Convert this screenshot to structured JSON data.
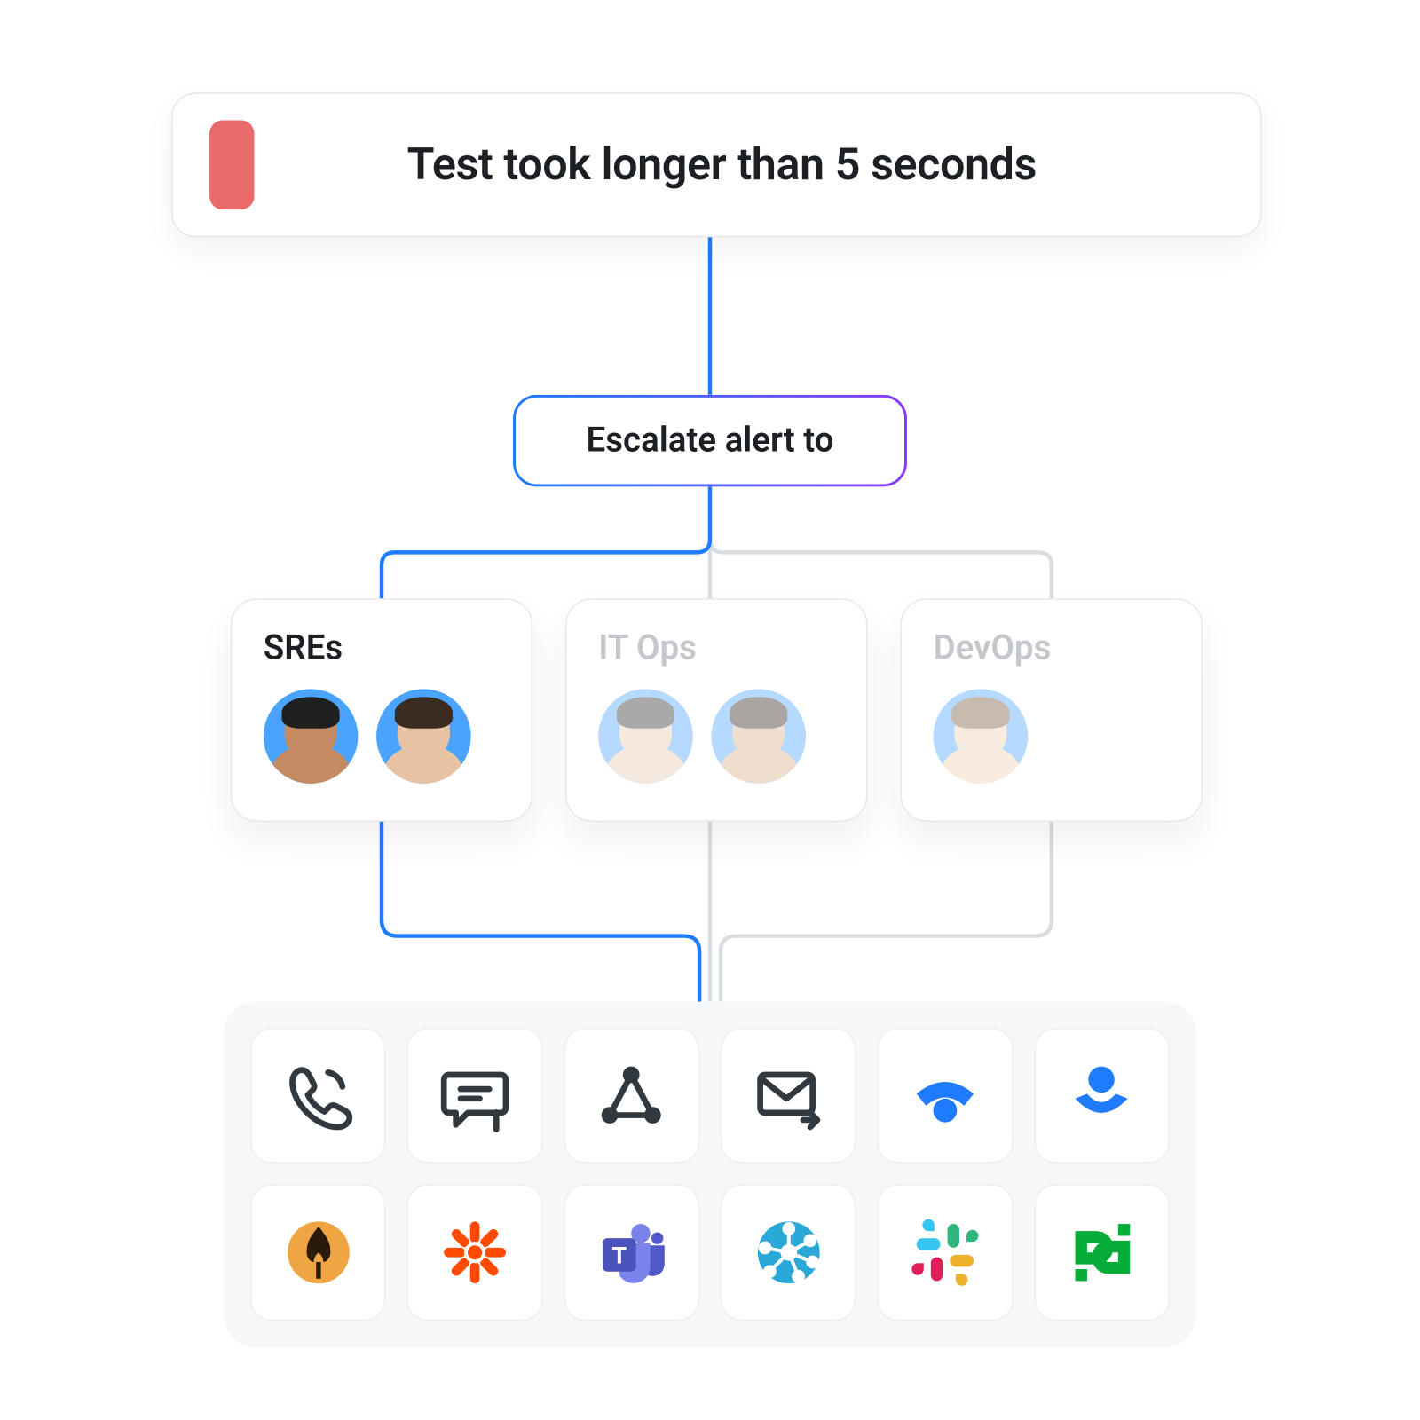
{
  "alert": {
    "text": "Test took longer than 5 seconds",
    "severity_color": "#e86a6a"
  },
  "escalate": {
    "label": "Escalate alert to"
  },
  "teams": [
    {
      "name": "SREs",
      "active": true,
      "members": 2
    },
    {
      "name": "IT Ops",
      "active": false,
      "members": 2
    },
    {
      "name": "DevOps",
      "active": false,
      "members": 1
    }
  ],
  "channels": [
    {
      "id": "phone",
      "label": "Phone call"
    },
    {
      "id": "sms",
      "label": "SMS / message"
    },
    {
      "id": "webhook",
      "label": "Webhook"
    },
    {
      "id": "email",
      "label": "Email"
    },
    {
      "id": "statuspage",
      "label": "Status page"
    },
    {
      "id": "opsgenie",
      "label": "Opsgenie"
    },
    {
      "id": "firehydrant",
      "label": "FireHydrant"
    },
    {
      "id": "zapier",
      "label": "Zapier"
    },
    {
      "id": "teams",
      "label": "Microsoft Teams"
    },
    {
      "id": "hub",
      "label": "Integration hub"
    },
    {
      "id": "slack",
      "label": "Slack"
    },
    {
      "id": "pagerduty",
      "label": "PagerDuty"
    }
  ],
  "colors": {
    "blue": "#1f7bff",
    "purple": "#8a3bff"
  }
}
